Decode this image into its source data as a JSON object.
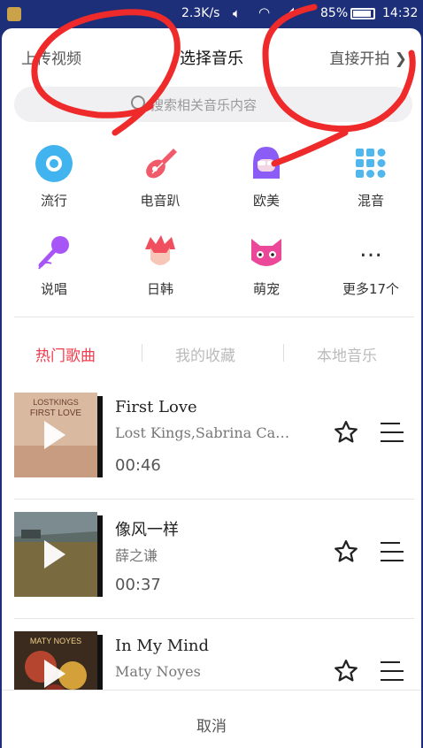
{
  "status_bar": {
    "network_speed": "2.3K/s",
    "battery_percent": "85%",
    "time": "14:32"
  },
  "header": {
    "upload_label": "上传视频",
    "title": "选择音乐",
    "start_label": "直接开拍"
  },
  "search": {
    "placeholder": "搜索相关音乐内容"
  },
  "categories": [
    {
      "label": "流行",
      "icon": "vinyl-disc-icon",
      "color": "#41b3ee"
    },
    {
      "label": "电音趴",
      "icon": "electric-guitar-icon",
      "color": "#f05a6a"
    },
    {
      "label": "欧美",
      "icon": "purple-hair-girl-icon",
      "color": "#8b5cf6"
    },
    {
      "label": "混音",
      "icon": "dot-grid-icon",
      "color": "#4fb6ee"
    },
    {
      "label": "说唱",
      "icon": "microphone-icon",
      "color": "#a855f7"
    },
    {
      "label": "日韩",
      "icon": "red-hair-boy-icon",
      "color": "#ef4f5f"
    },
    {
      "label": "萌宠",
      "icon": "pink-cat-icon",
      "color": "#ec4899"
    },
    {
      "label": "更多17个",
      "icon": "more-dots-icon",
      "color": "#333333"
    }
  ],
  "tabs": [
    {
      "label": "热门歌曲",
      "active": true
    },
    {
      "label": "我的收藏",
      "active": false
    },
    {
      "label": "本地音乐",
      "active": false
    }
  ],
  "songs": [
    {
      "name": "First Love",
      "artist": "Lost Kings,Sabrina Carpenter",
      "duration": "00:46",
      "cover_title": "LOSTKINGS",
      "cover_subtitle": "FIRST LOVE"
    },
    {
      "name": "像风一样",
      "artist": "薛之谦",
      "duration": "00:37"
    },
    {
      "name": "In My Mind",
      "artist": "Maty Noyes",
      "duration": "",
      "cover_title": "MATY NOYES"
    }
  ],
  "footer": {
    "cancel_label": "取消"
  },
  "colors": {
    "accent": "#f23c4d",
    "status_bar": "#1e2f7a",
    "scribble": "#ee2a2a"
  }
}
